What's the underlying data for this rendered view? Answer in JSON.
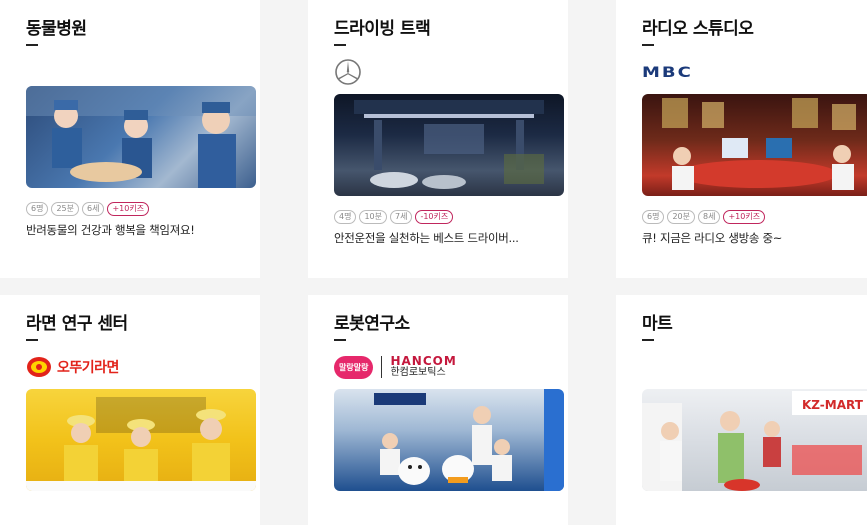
{
  "cards": [
    {
      "title": "동물병원",
      "tags": [
        "6명",
        "25분",
        "6세",
        "+10키즈"
      ],
      "description": "반려동물의 건강과 행복을 책임져요!",
      "colors": {
        "photo_bg": "#3b5c8a"
      }
    },
    {
      "title": "드라이빙 트랙",
      "logo": {
        "icon": "mercedes-star-icon"
      },
      "tags": [
        "4명",
        "10분",
        "7세",
        "-10키즈"
      ],
      "description": "안전운전을 실천하는 베스트 드라이버...",
      "colors": {
        "photo_bg": "#1a2233"
      }
    },
    {
      "title": "라디오 스튜디오",
      "logo": {
        "text": "MBC"
      },
      "tags": [
        "6명",
        "20분",
        "8세",
        "+10키즈"
      ],
      "description": "큐! 지금은 라디오 생방송 중~",
      "colors": {
        "photo_bg": "#5a2418"
      }
    },
    {
      "title": "라면 연구 센터",
      "logo": {
        "text": "오뚜기라면",
        "icon": "ottogi-logo-icon"
      },
      "colors": {
        "photo_bg": "#f2c21a"
      }
    },
    {
      "title": "로봇연구소",
      "logo": {
        "badge": "말랑말랑",
        "brand": "HANCOM",
        "sub": "한컴로보틱스"
      },
      "colors": {
        "photo_bg": "#1f4f8f"
      }
    },
    {
      "title": "마트",
      "photo_sign": "KZ-MART",
      "colors": {
        "photo_bg": "#d9dde3"
      }
    }
  ]
}
